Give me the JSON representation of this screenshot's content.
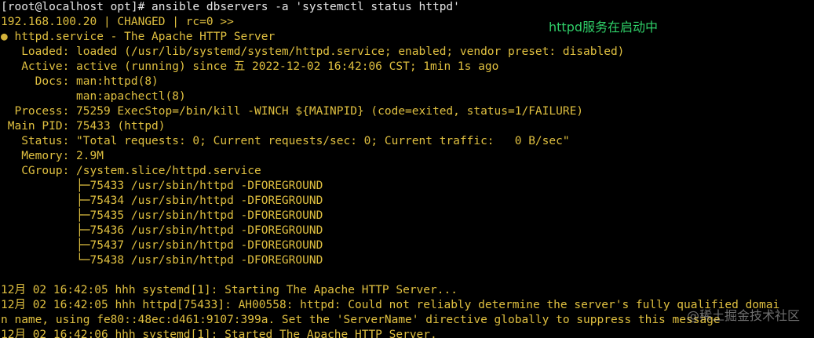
{
  "colors": {
    "background": "#000000",
    "normal_text": "#e6e6e6",
    "output_text": "#e0c040",
    "annotation": "#2fcf68"
  },
  "terminal": {
    "prompt_line": "[root@localhost opt]# ansible dbservers -a 'systemctl status httpd'",
    "result_header": "192.168.100.20 | CHANGED | rc=0 >>",
    "service_bullet": "●",
    "service_line": " httpd.service - The Apache HTTP Server",
    "loaded": "   Loaded: loaded (/usr/lib/systemd/system/httpd.service; enabled; vendor preset: disabled)",
    "active": "   Active: active (running) since 五 2022-12-02 16:42:06 CST; 1min 1s ago",
    "docs_1": "     Docs: man:httpd(8)",
    "docs_2": "           man:apachectl(8)",
    "process": "  Process: 75259 ExecStop=/bin/kill -WINCH ${MAINPID} (code=exited, status=1/FAILURE)",
    "main_pid": " Main PID: 75433 (httpd)",
    "status": "   Status: \"Total requests: 0; Current requests/sec: 0; Current traffic:   0 B/sec\"",
    "memory": "   Memory: 2.9M",
    "cgroup": "   CGroup: /system.slice/httpd.service",
    "cgroup_children": [
      "           ├─75433 /usr/sbin/httpd -DFOREGROUND",
      "           ├─75434 /usr/sbin/httpd -DFOREGROUND",
      "           ├─75435 /usr/sbin/httpd -DFOREGROUND",
      "           ├─75436 /usr/sbin/httpd -DFOREGROUND",
      "           ├─75437 /usr/sbin/httpd -DFOREGROUND",
      "           └─75438 /usr/sbin/httpd -DFOREGROUND"
    ],
    "log_lines": [
      "12月 02 16:42:05 hhh systemd[1]: Starting The Apache HTTP Server...",
      "12月 02 16:42:05 hhh httpd[75433]: AH00558: httpd: Could not reliably determine the server's fully qualified domai",
      "n name, using fe80::48ec:d461:9107:399a. Set the 'ServerName' directive globally to suppress this message",
      "12月 02 16:42:06 hhh systemd[1]: Started The Apache HTTP Server."
    ]
  },
  "annotation_text": "httpd服务在启动中",
  "watermark_text": "@稀土掘金技术社区"
}
